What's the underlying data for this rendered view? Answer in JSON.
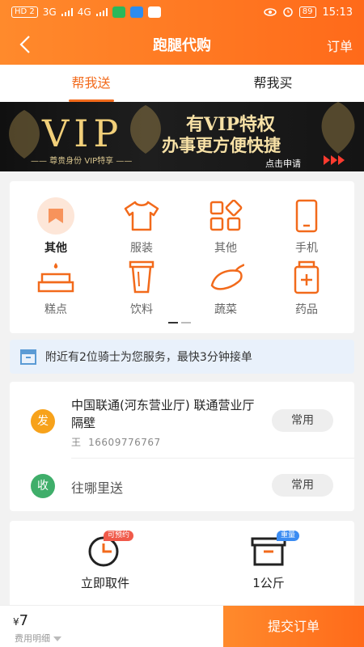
{
  "status_bar": {
    "left_badge": "HD 2",
    "network_1": "3G",
    "network_2": "4G",
    "battery": "89",
    "time": "15:13"
  },
  "header": {
    "title": "跑腿代购",
    "right_action": "订单"
  },
  "tabs": [
    {
      "label": "帮我送",
      "active": true
    },
    {
      "label": "帮我买",
      "active": false
    }
  ],
  "banner": {
    "vip": "VIP",
    "sub": "—— 尊贵身份 VIP特享 ——",
    "line1": "有VIP特权",
    "line2": "办事更方便快捷",
    "cta": "点击申请"
  },
  "categories": [
    {
      "label": "其他",
      "icon": "bookmark-icon",
      "selected": true
    },
    {
      "label": "服装",
      "icon": "shirt-icon",
      "selected": false
    },
    {
      "label": "其他",
      "icon": "grid-icon",
      "selected": false
    },
    {
      "label": "手机",
      "icon": "phone-icon",
      "selected": false
    },
    {
      "label": "糕点",
      "icon": "cake-icon",
      "selected": false
    },
    {
      "label": "饮料",
      "icon": "cup-icon",
      "selected": false
    },
    {
      "label": "蔬菜",
      "icon": "eggplant-icon",
      "selected": false
    },
    {
      "label": "药品",
      "icon": "medicine-icon",
      "selected": false
    }
  ],
  "notice": {
    "text": "附近有2位骑士为您服务，最快3分钟接单"
  },
  "sender": {
    "badge": "发",
    "address": "中国联通(河东营业厅) 联通营业厅隔壁",
    "name": "王",
    "phone": "16609776767",
    "frequent": "常用"
  },
  "receiver": {
    "badge": "收",
    "placeholder": "往哪里送",
    "frequent": "常用"
  },
  "options": {
    "pickup": {
      "label": "立即取件",
      "badge": "可预约"
    },
    "weight": {
      "label": "1公斤",
      "badge": "重量"
    }
  },
  "footer": {
    "currency": "¥",
    "amount": "7",
    "detail": "费用明细",
    "submit": "提交订单"
  },
  "colors": {
    "accent": "#f26a1b",
    "sender_badge": "#f7a21b",
    "receiver_badge": "#3fae6a",
    "notice_bg": "#e9f1fb"
  }
}
